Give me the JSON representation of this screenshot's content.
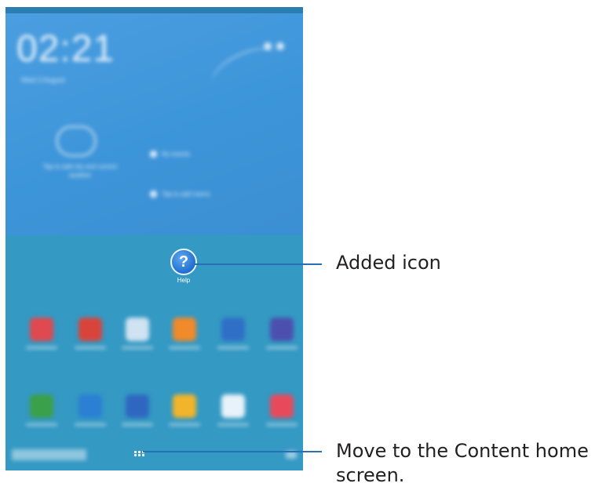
{
  "device": {
    "clock": "02:21",
    "date": "Wed 3 August",
    "weather_text": "Tap to add city and current weather",
    "widget_rows": [
      "No events",
      "Tap to add memo"
    ]
  },
  "added_app": {
    "label": "Help",
    "glyph": "?",
    "icon": "help-icon"
  },
  "app_grid": [
    [
      {
        "icon": "calendar-icon",
        "color": "#e0494f"
      },
      {
        "icon": "chrome-icon",
        "color": "#d9443a"
      },
      {
        "icon": "video-icon",
        "color": "#cfe3f2"
      },
      {
        "icon": "contacts-icon",
        "color": "#f08a2a"
      },
      {
        "icon": "internet-icon",
        "color": "#2f6fc6"
      },
      {
        "icon": "camera-icon",
        "color": "#4c4fae"
      }
    ],
    [
      {
        "icon": "maps-icon",
        "color": "#3aa04a"
      },
      {
        "icon": "remote-icon",
        "color": "#2b7fd4"
      },
      {
        "icon": "people-icon",
        "color": "#2f67c0"
      },
      {
        "icon": "folder-icon",
        "color": "#f2b42a"
      },
      {
        "icon": "store-icon",
        "color": "#e8f2fa"
      },
      {
        "icon": "ball-icon",
        "color": "#e84a5c"
      }
    ]
  ],
  "callouts": {
    "added_icon": "Added icon",
    "content_home": "Move to the Content home screen."
  },
  "colors": {
    "callout_line": "#2a6fb4",
    "screen_bg": "#3499c3"
  }
}
